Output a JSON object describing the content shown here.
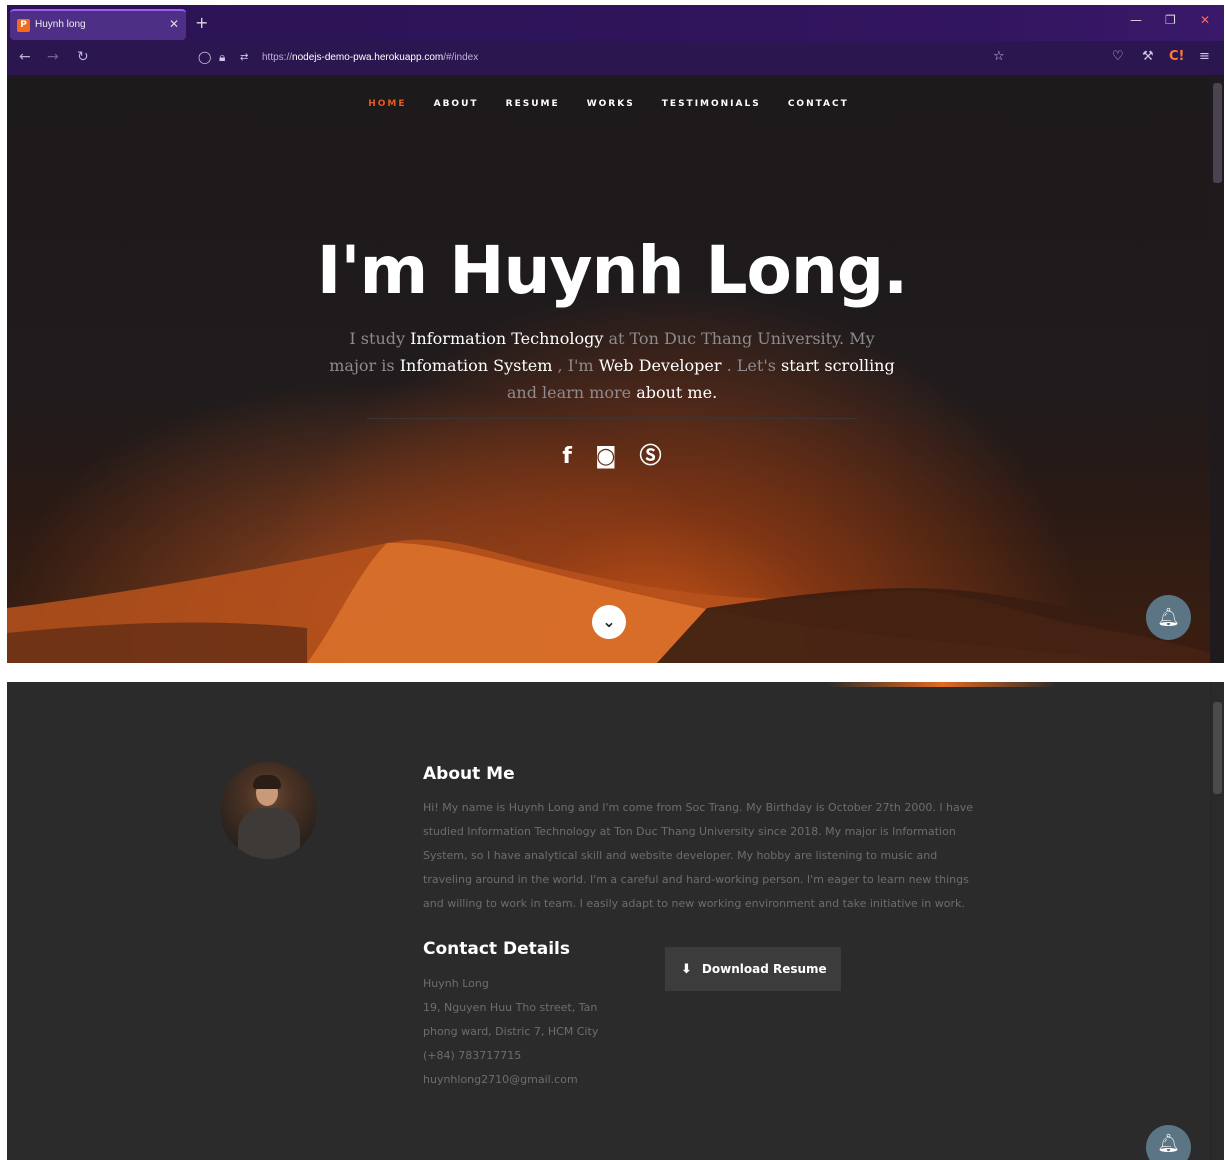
{
  "browser": {
    "tab_title": "Huynh long",
    "tab_favicon_letter": "P",
    "new_tab": "+",
    "url_scheme": "https://",
    "url_host": "nodejs-demo-pwa.herokuapp.com",
    "url_path": "/#/index"
  },
  "nav": {
    "items": [
      {
        "label": "HOME",
        "active": true
      },
      {
        "label": "ABOUT",
        "active": false
      },
      {
        "label": "RESUME",
        "active": false
      },
      {
        "label": "WORKS",
        "active": false
      },
      {
        "label": "TESTIMONIALS",
        "active": false
      },
      {
        "label": "CONTACT",
        "active": false
      }
    ]
  },
  "hero": {
    "headline": "I'm Huynh Long.",
    "intro_1": "I study ",
    "intro_2": "Information Technology",
    "intro_3": " at Ton Duc Thang University. My major is ",
    "intro_4": "Infomation System",
    "intro_5": " , I'm ",
    "intro_6": "Web Developer",
    "intro_7": " . Let's ",
    "intro_8": "start scrolling",
    "intro_9": " and learn more ",
    "intro_10": "about me",
    "intro_11": ".",
    "social": [
      "facebook-icon",
      "instagram-icon",
      "skype-icon"
    ]
  },
  "about": {
    "title": "About Me",
    "text": "Hi! My name is Huynh Long and I'm come from Soc Trang. My Birthday is October 27th 2000. I have studied Information Technology at Ton Duc Thang University since 2018. My major is Information System, so I have analytical skill and website developer. My hobby are listening to music and traveling around in the world. I'm a careful and hard-working person. I'm eager to learn new things and willing to work in team. I easily adapt to new working environment and take initiative in work."
  },
  "contact": {
    "title": "Contact Details",
    "name": "Huynh Long",
    "address": "19, Nguyen Huu Tho street, Tan phong ward, Distric 7, HCM City",
    "phone": "(+84) 783717715",
    "email": "huynhlong2710@gmail.com"
  },
  "download_label": "Download Resume",
  "colors": {
    "accent": "#e8591c",
    "bell": "#5c7584",
    "browser_chrome": "#2b1650"
  }
}
